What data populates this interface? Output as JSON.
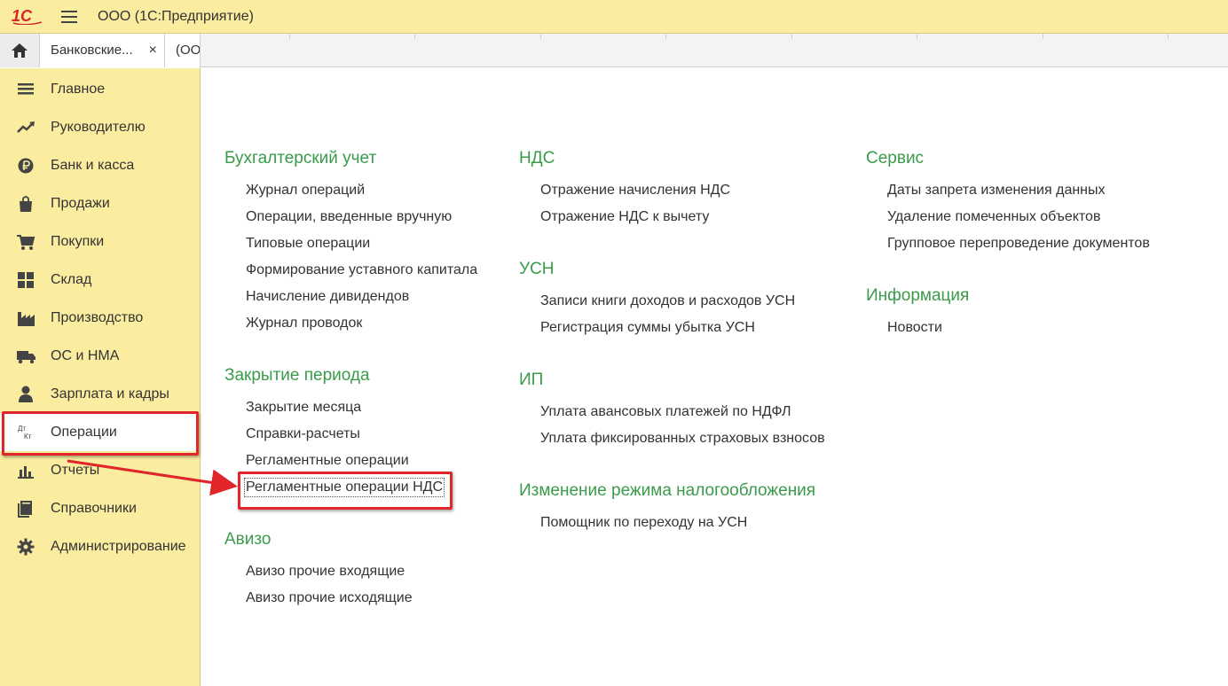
{
  "app": {
    "logo_text": "1С",
    "title": "ООО  (1С:Предприятие)"
  },
  "tabs": [
    {
      "label": "Банковские...",
      "close": "×"
    },
    {
      "label": "(ООО"
    }
  ],
  "sidebar": {
    "items": [
      {
        "label": "Главное",
        "icon": "list-icon"
      },
      {
        "label": "Руководителю",
        "icon": "trend-icon"
      },
      {
        "label": "Банк и касса",
        "icon": "ruble-icon"
      },
      {
        "label": "Продажи",
        "icon": "shopping-bag-icon"
      },
      {
        "label": "Покупки",
        "icon": "cart-icon"
      },
      {
        "label": "Склад",
        "icon": "grid-icon"
      },
      {
        "label": "Производство",
        "icon": "factory-icon"
      },
      {
        "label": "ОС и НМА",
        "icon": "truck-icon"
      },
      {
        "label": "Зарплата и кадры",
        "icon": "person-icon"
      },
      {
        "label": "Операции",
        "icon": "dt-kt-icon",
        "icon_text_top": "Дт",
        "icon_text_bottom": "Кт"
      },
      {
        "label": "Отчеты",
        "icon": "bar-chart-icon"
      },
      {
        "label": "Справочники",
        "icon": "books-icon"
      },
      {
        "label": "Администрирование",
        "icon": "gear-icon"
      }
    ]
  },
  "content": {
    "col1": {
      "sections": [
        {
          "title": "Бухгалтерский учет",
          "links": [
            "Журнал операций",
            "Операции, введенные вручную",
            "Типовые операции",
            "Формирование уставного капитала",
            "Начисление дивидендов",
            "Журнал проводок"
          ]
        },
        {
          "title": "Закрытие периода",
          "links": [
            "Закрытие месяца",
            "Справки-расчеты",
            "Регламентные операции",
            "Регламентные операции НДС"
          ]
        },
        {
          "title": "Авизо",
          "links": [
            "Авизо прочие входящие",
            "Авизо прочие исходящие"
          ]
        }
      ]
    },
    "col2": {
      "sections": [
        {
          "title": "НДС",
          "links": [
            "Отражение начисления НДС",
            "Отражение НДС к вычету"
          ]
        },
        {
          "title": "УСН",
          "links": [
            "Записи книги доходов и расходов УСН",
            "Регистрация суммы убытка УСН"
          ]
        },
        {
          "title": "ИП",
          "links": [
            "Уплата авансовых платежей по НДФЛ",
            "Уплата фиксированных страховых взносов"
          ]
        },
        {
          "title": "Изменение режима налогообложения",
          "links": [
            "Помощник по переходу на УСН"
          ]
        }
      ]
    },
    "col3": {
      "sections": [
        {
          "title": "Сервис",
          "links": [
            "Даты запрета изменения данных",
            "Удаление помеченных объектов",
            "Групповое перепроведение документов"
          ]
        },
        {
          "title": "Информация",
          "links": [
            "Новости"
          ]
        }
      ]
    }
  },
  "colors": {
    "accent_green": "#3a9b4a",
    "sidebar_bg": "#fbeda0",
    "annotation_red": "#e0262a",
    "logo_red": "#d8262a"
  }
}
